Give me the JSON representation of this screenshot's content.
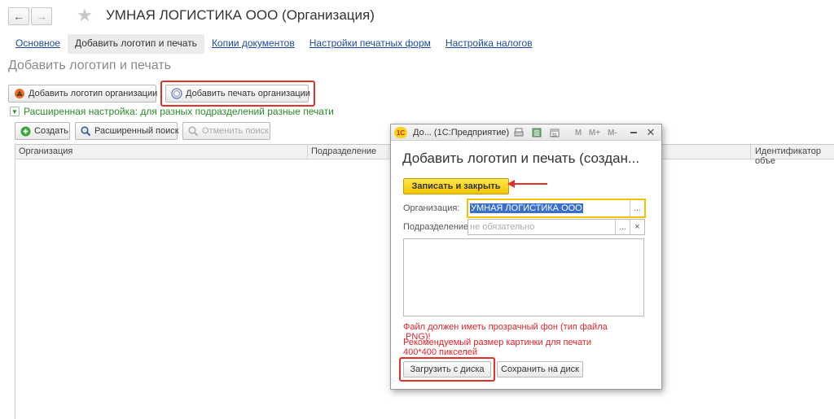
{
  "window": {
    "title": "УМНАЯ ЛОГИСТИКА ООО (Организация)"
  },
  "tabs": [
    {
      "label": "Основное",
      "active": false
    },
    {
      "label": "Добавить логотип и печать",
      "active": true
    },
    {
      "label": "Копии документов",
      "active": false
    },
    {
      "label": "Настройки печатных форм",
      "active": false
    },
    {
      "label": "Настройка налогов",
      "active": false
    }
  ],
  "section": {
    "title": "Добавить логотип и печать",
    "add_logo_label": "Добавить логотип организации",
    "add_stamp_label": "Добавить печать организации",
    "advanced_label": "Расширенная настройка: для разных подразделений разные печати"
  },
  "toolbar": {
    "create_label": "Создать",
    "adv_search_label": "Расширенный поиск",
    "cancel_search_label": "Отменить поиск"
  },
  "grid": {
    "columns": [
      "Организация",
      "Подразделение",
      "Идентификатор объе"
    ]
  },
  "dialog": {
    "window_title": "До... (1С:Предприятие)",
    "title": "Добавить логотип и печать (создан...",
    "save_close_label": "Записать и закрыть",
    "org_label": "Организация:",
    "org_value": "УМНАЯ ЛОГИСТИКА ООО",
    "division_label": "Подразделение:",
    "division_placeholder": "не обязательно",
    "warning1": "Файл должен иметь прозрачный фон (тип файла .PNG)!",
    "warning2": "Рекомендуемый размер картинки для печати 400*400 пикселей",
    "load_label": "Загрузить с диска",
    "save_disk_label": "Сохранить на диск",
    "calendar_day": "31",
    "memory_buttons": [
      "M",
      "M+",
      "M-"
    ]
  },
  "colors": {
    "highlight_box": "#e0312a",
    "link": "#1a4b9c",
    "advanced_text": "#2a8a2a",
    "warning_text": "#e0242a",
    "primary_button": "#f2c400"
  }
}
